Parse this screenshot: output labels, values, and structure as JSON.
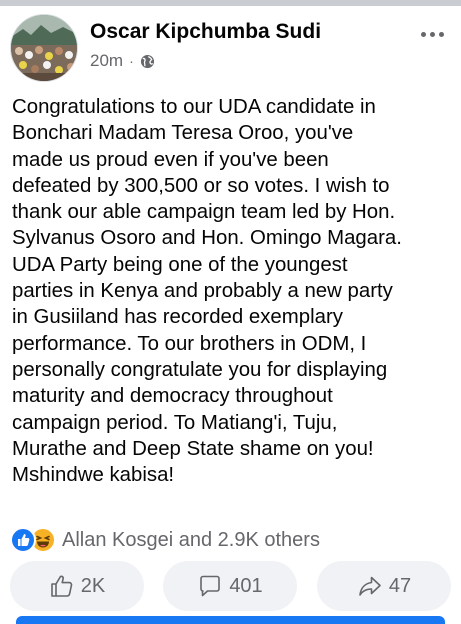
{
  "post": {
    "author": "Oscar Kipchumba Sudi",
    "time": "20m",
    "separator": "·",
    "audience_icon": "globe-icon",
    "text_lines": [
      "Congratulations to our UDA candidate in",
      "Bonchari Madam Teresa Oroo, you've",
      "made us proud even if you've been",
      "defeated by 300,500 or so votes. I wish to",
      "thank our able campaign team led by Hon.",
      "Sylvanus Osoro and Hon. Omingo Magara.",
      "UDA Party being one of the youngest",
      "parties in Kenya and probably a new party",
      "in Gusiiland has recorded exemplary",
      "performance. To our brothers in ODM, I",
      "personally congratulate you for displaying",
      "maturity and democracy throughout",
      "campaign period. To Matiang'i, Tuju,",
      "Murathe and Deep State shame on you!",
      "Mshindwe kabisa!"
    ]
  },
  "reactions": {
    "icons": [
      "like-reaction-icon",
      "haha-reaction-icon"
    ],
    "summary": "Allan Kosgei and 2.9K others"
  },
  "actions": {
    "like_count": "2K",
    "comment_count": "401",
    "share_count": "47"
  },
  "colors": {
    "accent": "#1877f2",
    "secondary_text": "#65676b",
    "button_bg": "#f0f2f5",
    "haha": "#f7b125"
  }
}
